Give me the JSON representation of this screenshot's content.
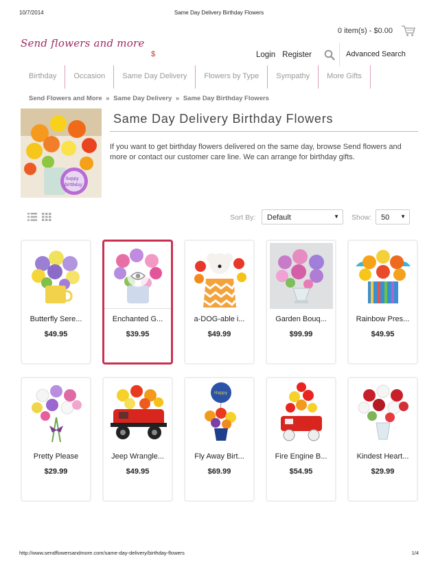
{
  "print": {
    "date": "10/7/2014",
    "title": "Same Day Delivery Birthday Flowers",
    "url": "http://www.sendflowersandmore.com/same-day-delivery/birthday-flowers",
    "page": "1/4"
  },
  "header": {
    "logo": "Send flowers and more",
    "currency": "$",
    "cart": "0 item(s) - $0.00",
    "login": "Login",
    "register": "Register",
    "advanced_search": "Advanced Search"
  },
  "nav": [
    "Birthday",
    "Occasion",
    "Same Day Delivery",
    "Flowers by Type",
    "Sympathy",
    "More Gifts"
  ],
  "breadcrumb": [
    "Send Flowers and More",
    "Same Day Delivery",
    "Same Day Birthday Flowers"
  ],
  "breadcrumb_sep": "»",
  "category": {
    "title": "Same Day Delivery Birthday Flowers",
    "description": "If you want to get birthday flowers delivered on the same day, browse Send flowers and more or contact our customer care line. We can arrange for birthday gifts."
  },
  "toolbar": {
    "sort_label": "Sort By:",
    "sort_value": "Default",
    "show_label": "Show:",
    "show_value": "50"
  },
  "products": [
    {
      "name": "Butterfly Sere...",
      "price": "$49.95"
    },
    {
      "name": "Enchanted G...",
      "price": "$39.95"
    },
    {
      "name": "a-DOG-able i...",
      "price": "$49.99"
    },
    {
      "name": "Garden Bouq...",
      "price": "$99.99"
    },
    {
      "name": "Rainbow Pres...",
      "price": "$49.95"
    },
    {
      "name": "Pretty Please",
      "price": "$29.99"
    },
    {
      "name": "Jeep Wrangle...",
      "price": "$49.95"
    },
    {
      "name": "Fly Away Birt...",
      "price": "$69.99"
    },
    {
      "name": "Fire Engine B...",
      "price": "$54.95"
    },
    {
      "name": "Kindest Heart...",
      "price": "$29.99"
    }
  ],
  "colors": {
    "logo": "#9b2a62",
    "nav_divider": "#d9a0bf",
    "selected_border": "#c9304f",
    "currency": "#c0392b"
  }
}
